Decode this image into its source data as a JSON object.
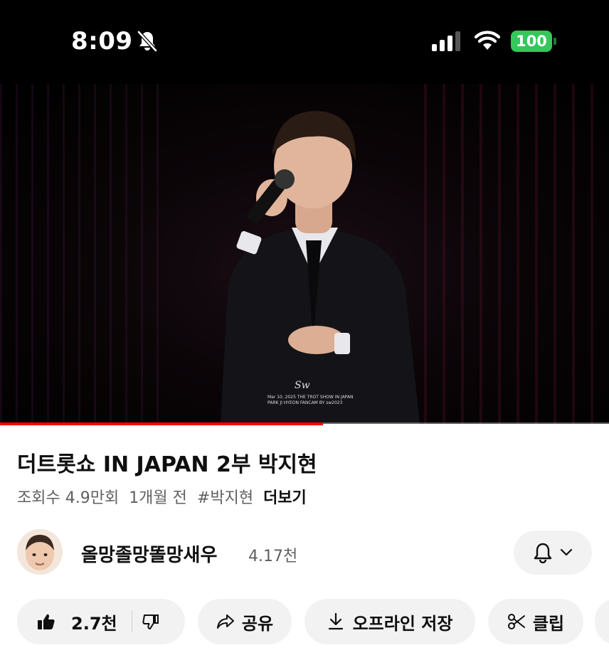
{
  "status_bar": {
    "time": "8:09",
    "battery": "100",
    "icons": [
      "bell-slash-icon",
      "cellular-signal-icon",
      "wifi-icon",
      "battery-icon"
    ]
  },
  "video": {
    "watermark_signature": "Sw",
    "watermark_line1": "Mar 10, 2025 THE TROT SHOW IN JAPAN",
    "watermark_line2": "PARK JI HYEON FANCAM BY sw2023",
    "progress_fraction": 0.53,
    "progress_color": "#ff0000"
  },
  "details": {
    "title": "더트롯쇼 IN JAPAN 2부 박지현",
    "views": "조회수 4.9만회",
    "age": "1개월 전",
    "hashtag": "#박지현",
    "more": "더보기"
  },
  "channel": {
    "name": "올망졸망똘망새우",
    "subscribers": "4.17천"
  },
  "actions": {
    "like_count": "2.7천",
    "share": "공유",
    "offline_save": "오프라인 저장",
    "clip": "클립"
  }
}
